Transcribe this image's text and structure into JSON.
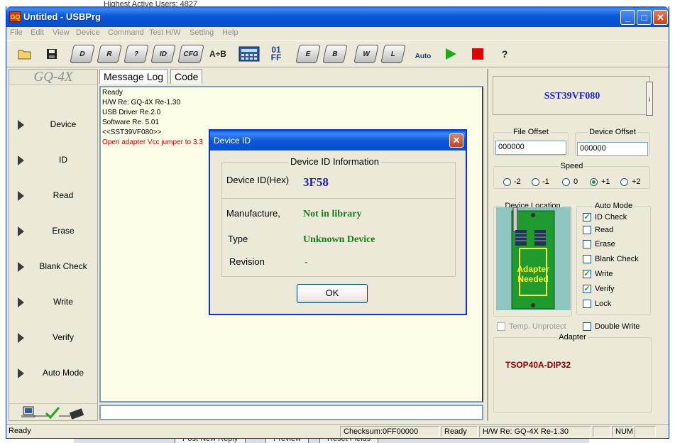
{
  "background": {
    "top_text": "Highest Active Users: 4827",
    "buttons": [
      "Post New Reply",
      "Preview",
      "Reset Fields"
    ]
  },
  "window": {
    "icon_text": "GQ",
    "title": "Untitled - USBPrg",
    "controls": {
      "minimize": "_",
      "maximize": "□",
      "close": "✕"
    }
  },
  "menu": [
    "File",
    "Edit",
    "View",
    "Device",
    "Command",
    "Test H/W",
    "Setting",
    "Help"
  ],
  "toolbar": {
    "open_icon": "open-folder-icon",
    "save_icon": "save-disk-icon",
    "chips": [
      "D",
      "R",
      "?",
      "ID",
      "CFG"
    ],
    "compare_label": "A÷B",
    "hex_label_top": "01",
    "hex_label_bottom": "FF",
    "chips2": [
      "E",
      "B",
      "W",
      "L"
    ],
    "auto_label": "Auto",
    "help_label": "?"
  },
  "left_panel": {
    "logo": "GQ-4X",
    "items": [
      "Device",
      "ID",
      "Read",
      "Erase",
      "Blank Check",
      "Write",
      "Verify",
      "Auto Mode"
    ]
  },
  "tabs": [
    "Message Log",
    "Code"
  ],
  "log": [
    {
      "text": "Ready",
      "color": "#000000"
    },
    {
      "text": "H/W Re: GQ-4X Re-1.30",
      "color": "#000000"
    },
    {
      "text": "USB Driver Re.2.0",
      "color": "#000000"
    },
    {
      "text": "Software Re. 5.01",
      "color": "#000000"
    },
    {
      "text": "<<SST39VF080>>",
      "color": "#000000"
    },
    {
      "text": "Open adapter Vcc jumper to 3.3",
      "color": "#cc0000"
    }
  ],
  "right_panel": {
    "device_name": "SST39VF080",
    "info_button": "i",
    "file_offset_label": "File Offset",
    "file_offset_value": "000000",
    "device_offset_label": "Device Offset",
    "device_offset_value": "000000",
    "speed_label": "Speed",
    "speed_options": [
      "-2",
      "-1",
      "0",
      "+1",
      "+2"
    ],
    "speed_selected": "+1",
    "device_location_label": "Device Location",
    "adapter_needed_text": "Adapter Needed",
    "auto_mode_label": "Auto Mode",
    "auto_mode_items": [
      {
        "label": "ID Check",
        "checked": true
      },
      {
        "label": "Read",
        "checked": false
      },
      {
        "label": "Erase",
        "checked": false
      },
      {
        "label": "Blank Check",
        "checked": false
      },
      {
        "label": "Write",
        "checked": true
      },
      {
        "label": "Verify",
        "checked": true
      },
      {
        "label": "Lock",
        "checked": false
      }
    ],
    "temp_unprotect_label": "Temp. Unprotect",
    "double_write_label": "Double Write",
    "adapter_label": "Adapter",
    "adapter_value": "TSOP40A-DIP32"
  },
  "statusbar": {
    "left": "Ready",
    "checksum": "Checksum:0FF00000",
    "state": "Ready",
    "hw": "H/W Re: GQ-4X Re-1.30",
    "num": "NUM"
  },
  "dialog": {
    "title": "Device ID",
    "close": "✕",
    "group_title": "Device ID Information",
    "device_id_label": "Device ID(Hex)",
    "device_id_value": "3F58",
    "manufacture_label": "Manufacture,",
    "manufacture_value": "Not in library",
    "type_label": "Type",
    "type_value": "Unknown Device",
    "revision_label": "Revision",
    "revision_value": "-",
    "ok_label": "OK"
  },
  "colors": {
    "accent_blue": "#0831d9",
    "value_green": "#1a7a1a",
    "device_blue": "#1f22cc",
    "adapter_red": "#8b0000"
  }
}
